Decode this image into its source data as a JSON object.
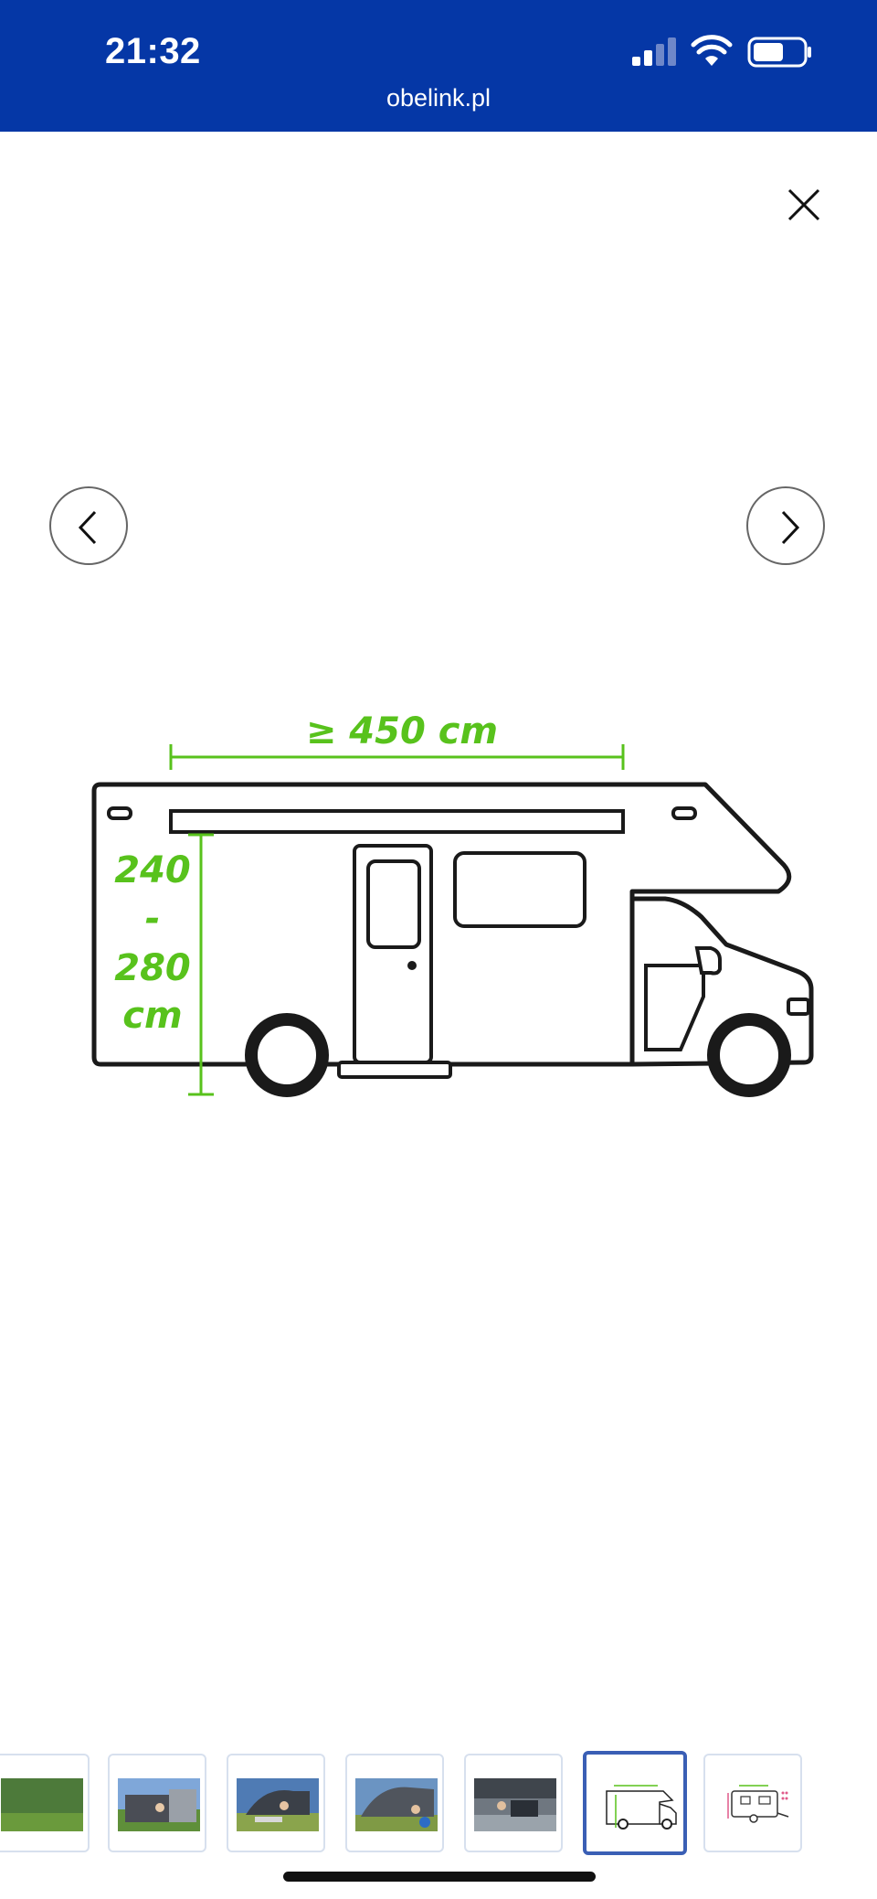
{
  "status_bar": {
    "time": "21:32",
    "domain": "obelink.pl",
    "background_color": "#0537a6"
  },
  "viewer": {
    "close_icon": "close-icon",
    "prev_icon": "chevron-left-icon",
    "next_icon": "chevron-right-icon"
  },
  "image": {
    "length_label": "≥ 450 cm",
    "height_label_line1": "240",
    "height_label_line2": "-",
    "height_label_line3": "280",
    "height_label_line4": "cm",
    "dimension_color": "#58c21c"
  },
  "thumbnails": {
    "count": 7,
    "active_index": 5,
    "items": [
      {
        "kind": "photo"
      },
      {
        "kind": "photo"
      },
      {
        "kind": "photo"
      },
      {
        "kind": "photo"
      },
      {
        "kind": "photo"
      },
      {
        "kind": "drawing-motorhome"
      },
      {
        "kind": "drawing-caravan"
      }
    ]
  }
}
